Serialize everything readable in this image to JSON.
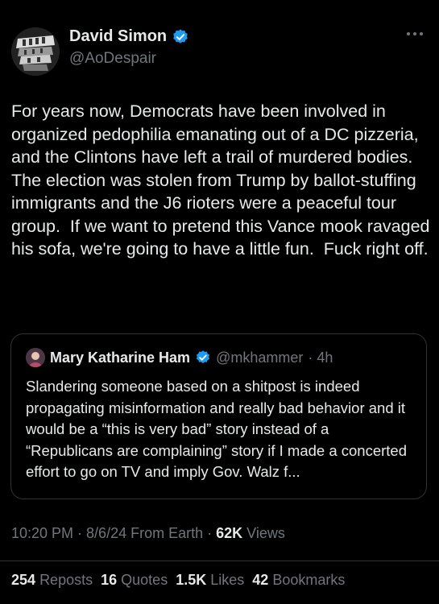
{
  "author": {
    "name": "David Simon",
    "handle": "@AoDespair",
    "avatar_icon": "avatar-bw-photo",
    "verified_color": "#1d9bf0"
  },
  "post": {
    "text": "For years now, Democrats have been involved in organized pedophilia emanating out of a DC pizzeria, and the Clintons have left a trail of murdered bodies. The election was stolen from Trump by ballot-stuffing immigrants and the J6 rioters were a peaceful tour group.  If we want to pretend this Vance mook ravaged his sofa, we're going to have a little fun.  Fuck right off."
  },
  "quote": {
    "name": "Mary Katharine Ham",
    "handle": "@mkhammer",
    "time": "· 4h",
    "text": "Slandering someone based on a shitpost is indeed propagating misinformation and really bad behavior and it would be a “this is very bad” story instead of a “Republicans are complaining” story if I made a concerted effort to go on TV and imply Gov. Walz f..."
  },
  "meta": {
    "time": "10:20 PM · 8/6/24 From Earth · ",
    "views_count": "62K",
    "views_label": "Views"
  },
  "stats": {
    "reposts_count": "254",
    "reposts_label": "Reposts",
    "quotes_count": "16",
    "quotes_label": "Quotes",
    "likes_count": "1.5K",
    "likes_label": "Likes",
    "bookmarks_count": "42",
    "bookmarks_label": "Bookmarks"
  }
}
